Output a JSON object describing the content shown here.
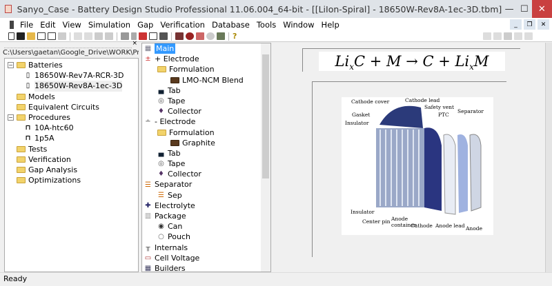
{
  "window": {
    "title": "Sanyo_Case - Battery Design Studio Professional 11.06.004_64-bit - [[LiIon-Spiral] - 18650W-Rev8A-1ec-3D.tbm]",
    "minimize": "—",
    "maximize": "☐",
    "close": "✕"
  },
  "menu": [
    "File",
    "Edit",
    "View",
    "Simulation",
    "Gap",
    "Verification",
    "Database",
    "Tools",
    "Window",
    "Help"
  ],
  "mdi": {
    "minimize": "_",
    "restore": "❐",
    "close": "✕"
  },
  "left": {
    "close": "×",
    "path": "C:\\Users\\gaetan\\Google_Drive\\WORK\\Presentations",
    "tree": [
      {
        "label": "Batteries",
        "type": "folder",
        "expand": "−",
        "level": 0
      },
      {
        "label": "18650W-Rev7A-RCR-3D",
        "type": "battery",
        "level": 1
      },
      {
        "label": "18650W-Rev8A-1ec-3D",
        "type": "battery",
        "level": 1
      },
      {
        "label": "Models",
        "type": "folder",
        "level": 0
      },
      {
        "label": "Equivalent Circuits",
        "type": "folder",
        "level": 0
      },
      {
        "label": "Procedures",
        "type": "folder",
        "expand": "−",
        "level": 0
      },
      {
        "label": "10A-htc60",
        "type": "procedure",
        "level": 1
      },
      {
        "label": "1p5A",
        "type": "procedure",
        "level": 1
      },
      {
        "label": "Tests",
        "type": "folder",
        "level": 0
      },
      {
        "label": "Verification",
        "type": "folder",
        "level": 0
      },
      {
        "label": "Gap Analysis",
        "type": "folder",
        "level": 0
      },
      {
        "label": "Optimizations",
        "type": "folder",
        "level": 0
      }
    ]
  },
  "design_tree": [
    {
      "label": "Main",
      "icon": "main",
      "level": 0,
      "selected": true
    },
    {
      "label": "+ Electrode",
      "icon": "pos-electrode",
      "level": 0
    },
    {
      "label": "Formulation",
      "icon": "folder",
      "level": 1
    },
    {
      "label": "LMO-NCM Blend",
      "icon": "dark-folder",
      "level": 2
    },
    {
      "label": "Tab",
      "icon": "tab",
      "level": 1
    },
    {
      "label": "Tape",
      "icon": "tape",
      "level": 1
    },
    {
      "label": "Collector",
      "icon": "collector",
      "level": 1
    },
    {
      "label": "- Electrode",
      "icon": "neg-electrode",
      "level": 0
    },
    {
      "label": "Formulation",
      "icon": "folder",
      "level": 1
    },
    {
      "label": "Graphite",
      "icon": "dark-folder",
      "level": 2
    },
    {
      "label": "Tab",
      "icon": "tab",
      "level": 1
    },
    {
      "label": "Tape",
      "icon": "tape",
      "level": 1
    },
    {
      "label": "Collector",
      "icon": "collector",
      "level": 1
    },
    {
      "label": "Separator",
      "icon": "separator",
      "level": 0
    },
    {
      "label": "Sep",
      "icon": "separator",
      "level": 1
    },
    {
      "label": "Electrolyte",
      "icon": "electrolyte",
      "level": 0
    },
    {
      "label": "Package",
      "icon": "package",
      "level": 0
    },
    {
      "label": "Can",
      "icon": "radio-checked",
      "level": 1
    },
    {
      "label": "Pouch",
      "icon": "radio",
      "level": 1
    },
    {
      "label": "Internals",
      "icon": "internals",
      "level": 0
    },
    {
      "label": "Cell Voltage",
      "icon": "cell-voltage",
      "level": 0
    },
    {
      "label": "Builders",
      "icon": "builders",
      "level": 0
    }
  ],
  "equation": "LixC + M → C + LixM",
  "diagram_labels": {
    "cathode_cover": "Cathode cover",
    "cathode_lead": "Cathode lead",
    "safety_vent": "Safety vent",
    "gasket": "Gasket",
    "ptc": "PTC",
    "separator": "Separator",
    "insulator_top": "Insulator",
    "insulator_bottom": "Insulator",
    "center_pin": "Center pin",
    "anode_container": "Anode container",
    "cathode": "Cathode",
    "anode_lead": "Anode lead",
    "anode": "Anode"
  },
  "status": "Ready"
}
